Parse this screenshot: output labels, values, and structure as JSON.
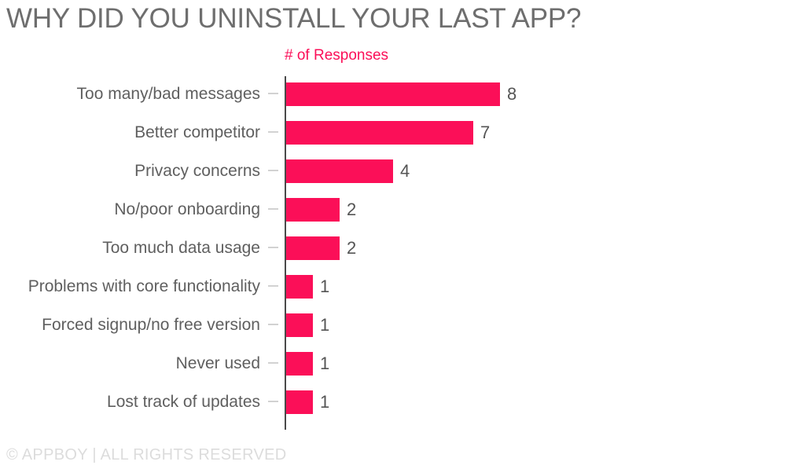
{
  "chart_data": {
    "type": "bar",
    "orientation": "horizontal",
    "title": "WHY DID YOU UNINSTALL YOUR LAST APP?",
    "xlabel": "# of Responses",
    "ylabel": "",
    "axis_title": "# of Responses",
    "categories": [
      "Too many/bad messages",
      "Better competitor",
      "Privacy concerns",
      "No/poor onboarding",
      "Too much data usage",
      "Problems with core functionality",
      "Forced signup/no free version",
      "Never used",
      "Lost track of updates"
    ],
    "values": [
      8,
      7,
      4,
      2,
      2,
      1,
      1,
      1,
      1
    ],
    "value_labels": [
      "8",
      "7",
      "4",
      "2",
      "2",
      "1",
      "1",
      "1",
      "1"
    ],
    "xlim": [
      0,
      8
    ],
    "grid": false,
    "legend": false,
    "bar_color": "#fb0f58",
    "axis_color": "#4a4a4a",
    "tick_color": "#d2d2d2",
    "label_color": "#5f5f5f",
    "value_color": "#555555",
    "title_color": "#6e6e6e",
    "axis_title_color": "#fb0f58"
  },
  "footer": {
    "text": "© APPBOY | ALL RIGHTS RESERVED",
    "color": "#dcdcdc"
  }
}
